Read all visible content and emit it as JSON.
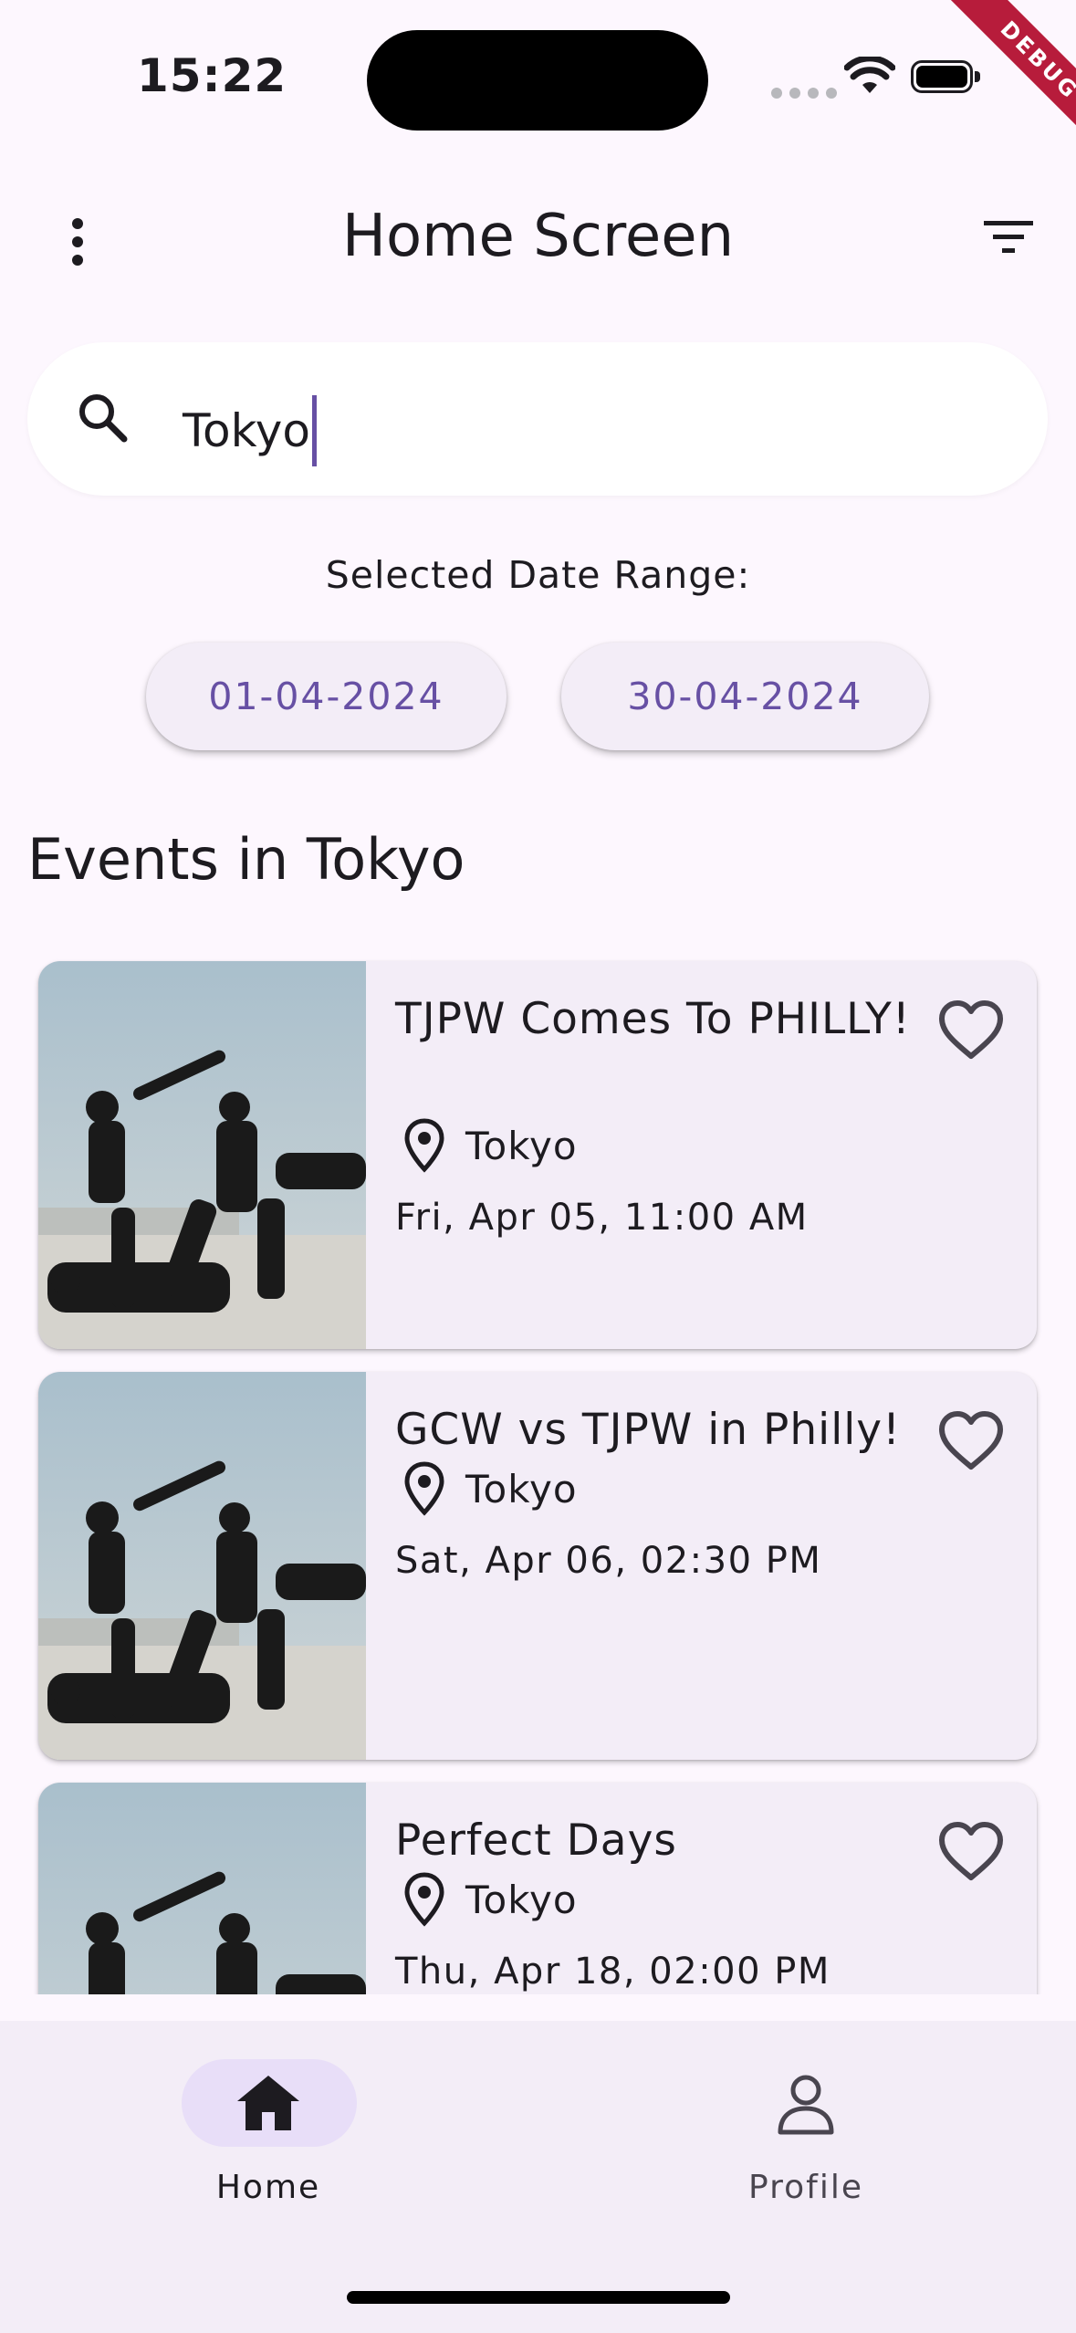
{
  "status_bar": {
    "time": "15:22"
  },
  "debug_banner": "DEBUG",
  "app_bar": {
    "title": "Home Screen",
    "menu_icon": "more-vert-icon",
    "filter_icon": "filter-icon"
  },
  "search": {
    "value": "Tokyo",
    "icon": "search-icon"
  },
  "date_range": {
    "label": "Selected Date Range:",
    "start": "01-04-2024",
    "end": "30-04-2024"
  },
  "section_title": "Events in Tokyo",
  "events": [
    {
      "title": "TJPW Comes To PHILLY!",
      "location": "Tokyo",
      "datetime": "Fri, Apr 05, 11:00 AM"
    },
    {
      "title": "GCW vs TJPW in Philly!",
      "location": "Tokyo",
      "datetime": "Sat, Apr 06, 02:30 PM"
    },
    {
      "title": "Perfect Days",
      "location": "Tokyo",
      "datetime": "Thu, Apr 18, 02:00 PM"
    }
  ],
  "bottom_nav": {
    "items": [
      {
        "label": "Home",
        "icon": "home-icon",
        "selected": true
      },
      {
        "label": "Profile",
        "icon": "person-icon",
        "selected": false
      }
    ]
  },
  "colors": {
    "primary": "#6750a4",
    "surface": "#fdf7fe",
    "card": "#f3edf7",
    "indicator": "#e8def8"
  }
}
